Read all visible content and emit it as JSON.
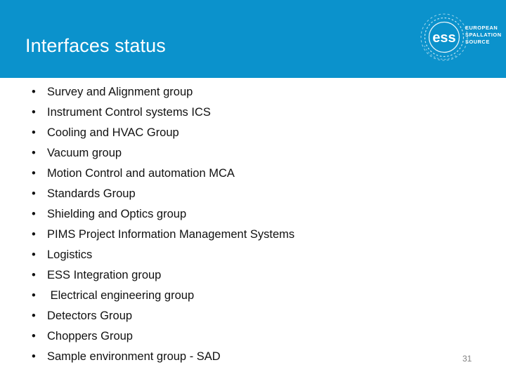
{
  "header": {
    "title": "Interfaces status",
    "background_color": "#0b92cc",
    "title_color": "#ffffff"
  },
  "logo": {
    "mark_text": "ess",
    "name_line1": "EUROPEAN",
    "name_line2": "SPALLATION",
    "name_line3": "SOURCE"
  },
  "list": {
    "bullet_glyph": "•",
    "items": [
      {
        "label": "Survey and Alignment group"
      },
      {
        "label": "Instrument Control systems ICS"
      },
      {
        "label": "Cooling and HVAC Group"
      },
      {
        "label": "Vacuum group"
      },
      {
        "label": "Motion Control and automation MCA"
      },
      {
        "label": "Standards Group"
      },
      {
        "label": "Shielding and Optics group"
      },
      {
        "label": "PIMS Project Information Management Systems"
      },
      {
        "label": "Logistics"
      },
      {
        "label": "ESS Integration group"
      },
      {
        "label": " Electrical engineering group"
      },
      {
        "label": "Detectors Group"
      },
      {
        "label": "Choppers Group"
      },
      {
        "label": "Sample environment group - SAD"
      }
    ]
  },
  "footer": {
    "page_number": "31",
    "page_number_color": "#808080"
  }
}
